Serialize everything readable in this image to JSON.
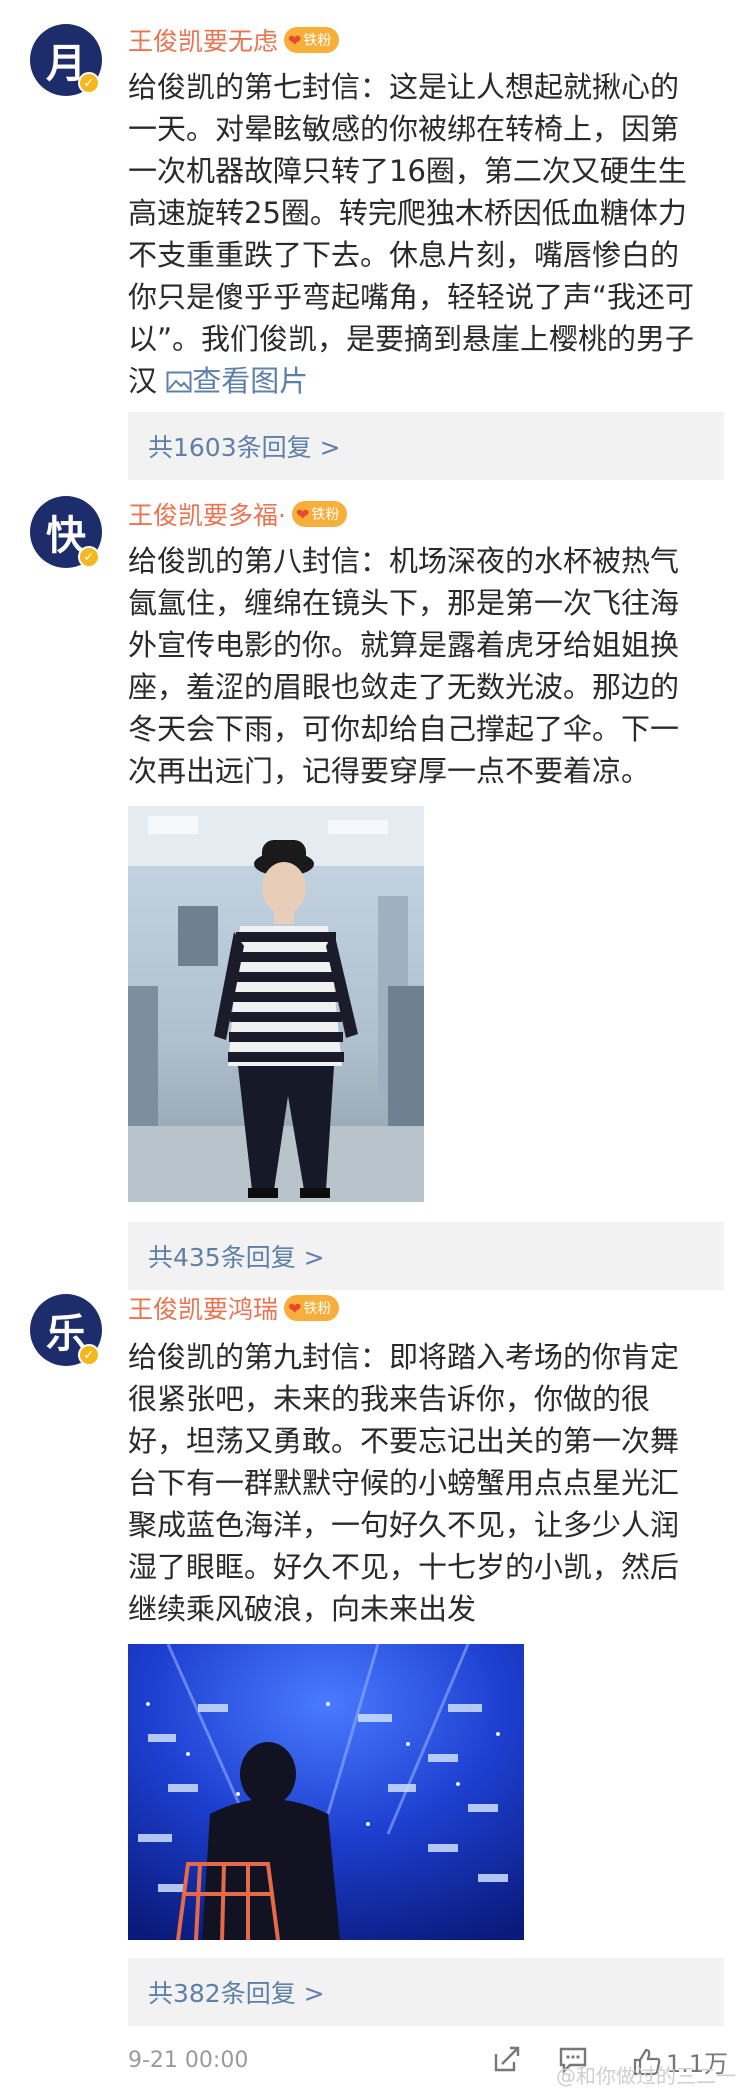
{
  "posts": [
    {
      "avatar_char": "月",
      "username": "王俊凯要无虑",
      "badge": "铁粉",
      "lines": [
        "给俊凯的第七封信：这是让人想起就揪心的",
        "一天。对晕眩敏感的你被绑在转椅上，因第",
        "一次机器故障只转了16圈，第二次又硬生生",
        "高速旋转25圈。转完爬独木桥因低血糖体力",
        "不支重重跌了下去。休息片刻，嘴唇惨白的",
        "你只是傻乎乎弯起嘴角，轻轻说了声“我还可",
        "以”。我们俊凯，是要摘到悬崖上樱桃的男子"
      ],
      "last_line": "汉",
      "view_pictures": "查看图片",
      "replies": "共1603条回复 >"
    },
    {
      "avatar_char": "快",
      "username": "王俊凯要多福·",
      "badge": "铁粉",
      "lines": [
        "给俊凯的第八封信：机场深夜的水杯被热气",
        "氤氲住，缠绵在镜头下，那是第一次飞往海",
        "外宣传电影的你。就算是露着虎牙给姐姐换",
        "座，羞涩的眉眼也敛走了无数光波。那边的",
        "冬天会下雨，可你却给自己撑起了伞。下一",
        "次再出远门，记得要穿厚一点不要着凉。"
      ],
      "replies": "共435条回复 >"
    },
    {
      "avatar_char": "乐",
      "username": "王俊凯要鸿瑞",
      "badge": "铁粉",
      "lines": [
        "给俊凯的第九封信：即将踏入考场的你肯定",
        "很紧张吧，未来的我来告诉你，你做的很",
        "好，坦荡又勇敢。不要忘记出关的第一次舞",
        "台下有一群默默守候的小螃蟹用点点星光汇",
        "聚成蓝色海洋，一句好久不见，让多少人润",
        "湿了眼眶。好久不见，十七岁的小凯，然后",
        "继续乘风破浪，向未来出发"
      ],
      "replies": "共382条回复 >"
    }
  ],
  "footer": {
    "timestamp": "9-21 00:00",
    "like_count": "1.1万",
    "watermark": "@和你做过的三二一"
  },
  "colors": {
    "username": "#eb7350",
    "link": "#5e80a8",
    "avatar_bg": "#1d2d6b",
    "badge_bg": "#f7ae3a",
    "reply_bg": "#f2f2f2"
  }
}
